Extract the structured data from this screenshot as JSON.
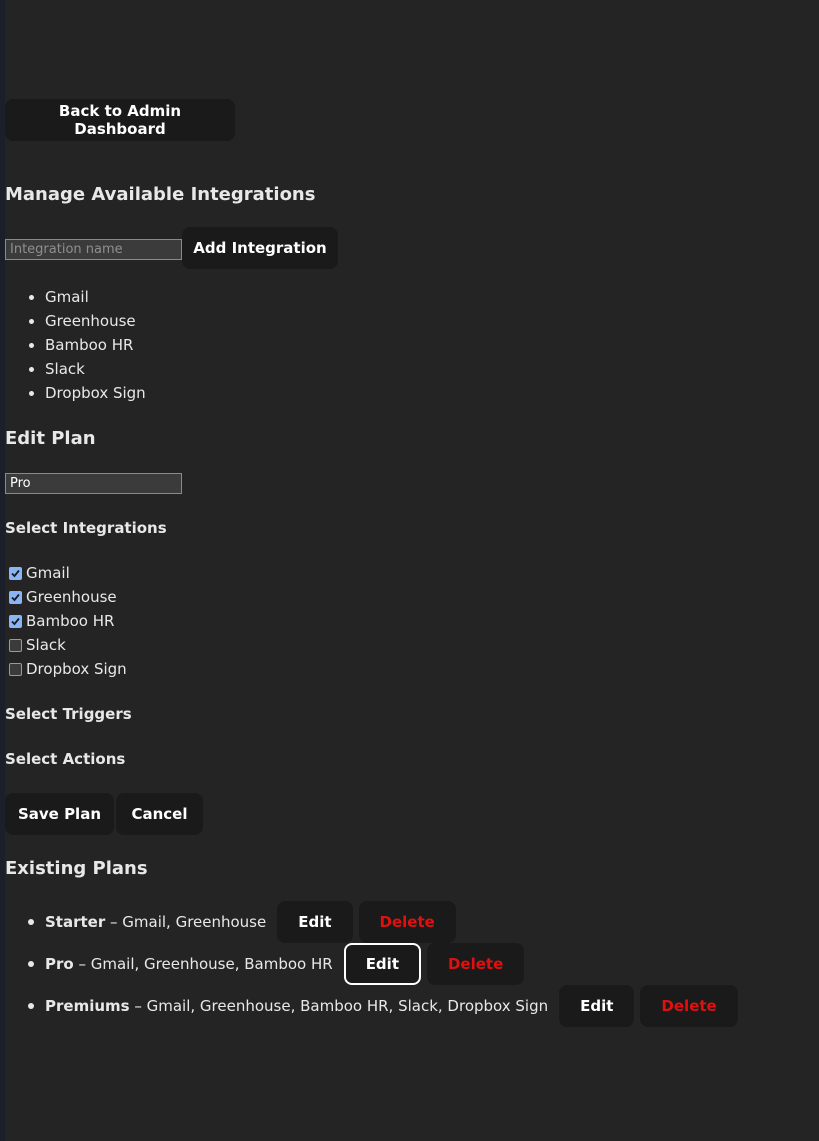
{
  "nav": {
    "back_label": "Back to Admin Dashboard"
  },
  "integrations_section": {
    "title": "Manage Available Integrations",
    "name_input": {
      "placeholder": "Integration name",
      "value": ""
    },
    "add_label": "Add Integration",
    "items": [
      "Gmail",
      "Greenhouse",
      "Bamboo HR",
      "Slack",
      "Dropbox Sign"
    ]
  },
  "edit_plan": {
    "title": "Edit Plan",
    "name_value": "Pro",
    "select_integrations_label": "Select Integrations",
    "integrations": [
      {
        "label": "Gmail",
        "checked": true
      },
      {
        "label": "Greenhouse",
        "checked": true
      },
      {
        "label": "Bamboo HR",
        "checked": true
      },
      {
        "label": "Slack",
        "checked": false
      },
      {
        "label": "Dropbox Sign",
        "checked": false
      }
    ],
    "select_triggers_label": "Select Triggers",
    "select_actions_label": "Select Actions",
    "save_label": "Save Plan",
    "cancel_label": "Cancel"
  },
  "existing_plans": {
    "title": "Existing Plans",
    "edit_label": "Edit",
    "delete_label": "Delete",
    "plans": [
      {
        "name": "Starter",
        "integrations": " – Gmail, Greenhouse"
      },
      {
        "name": "Pro",
        "integrations": " – Gmail, Greenhouse, Bamboo HR"
      },
      {
        "name": "Premiums",
        "integrations": " – Gmail, Greenhouse, Bamboo HR, Slack, Dropbox Sign"
      }
    ]
  },
  "colors": {
    "background": "#242424",
    "button_bg": "#1a1a1a",
    "danger_text": "#e01010",
    "checkbox_accent": "#8ab4f8"
  }
}
